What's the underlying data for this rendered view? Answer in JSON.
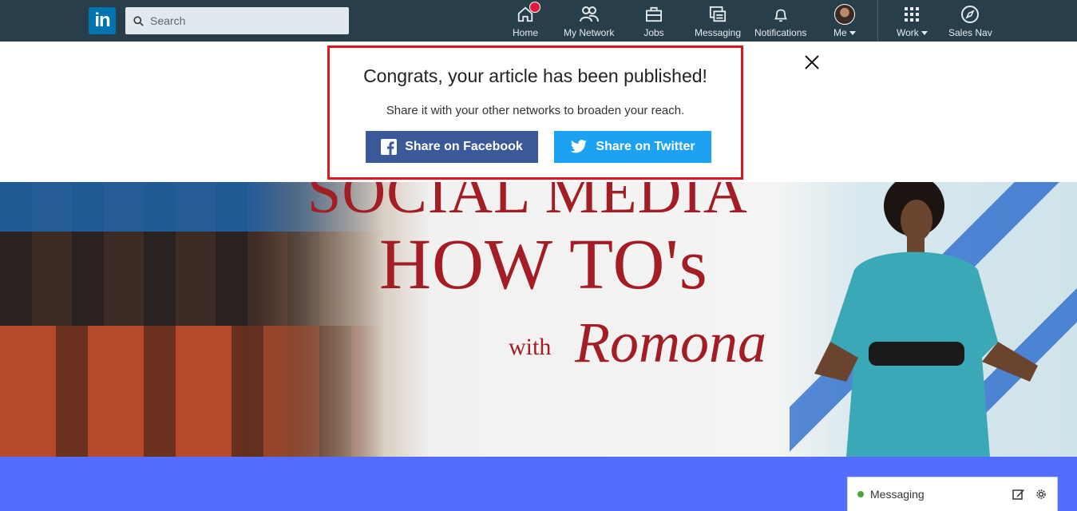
{
  "nav": {
    "logo_text": "in",
    "search_placeholder": "Search",
    "items": [
      {
        "label": "Home"
      },
      {
        "label": "My Network"
      },
      {
        "label": "Jobs"
      },
      {
        "label": "Messaging"
      },
      {
        "label": "Notifications"
      },
      {
        "label": "Me"
      },
      {
        "label": "Work"
      },
      {
        "label": "Sales Nav"
      }
    ]
  },
  "publish": {
    "title": "Congrats, your article has been published!",
    "subtitle": "Share it with your other networks to broaden your reach.",
    "facebook_label": "Share on Facebook",
    "twitter_label": "Share on Twitter"
  },
  "hero": {
    "line1": "SOCIAL MEDIA",
    "line2": "HOW TO's",
    "with": "with",
    "name": "Romona"
  },
  "messaging_tab": {
    "label": "Messaging"
  },
  "colors": {
    "nav_bg": "#283e4a",
    "facebook": "#3b5998",
    "twitter": "#1da1f2",
    "highlight_border": "#e0161e",
    "lower_band": "#536dfe"
  }
}
